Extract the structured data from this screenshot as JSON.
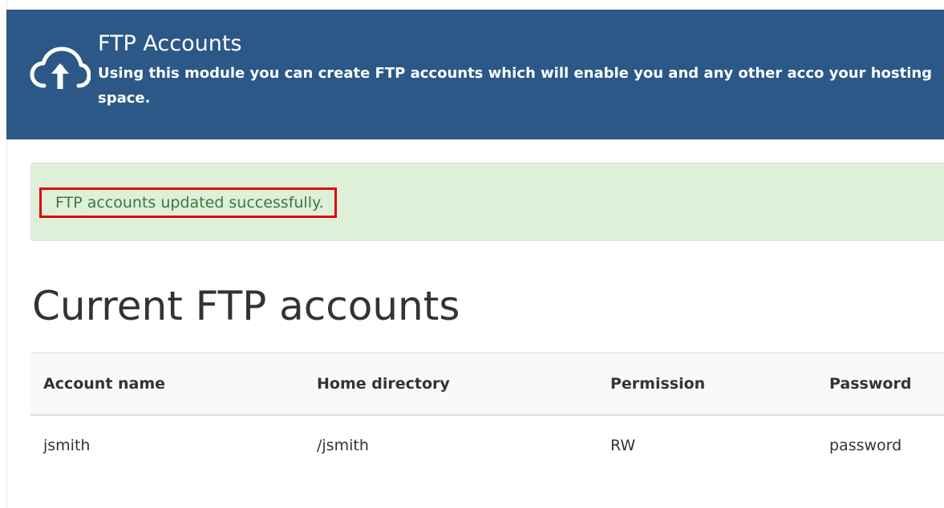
{
  "header": {
    "title": "FTP Accounts",
    "description": "Using this module you can create FTP accounts which will enable you and any other acco your hosting space.",
    "icon": "cloud-upload-icon",
    "background_color": "#2c5888"
  },
  "alert": {
    "message": "FTP accounts updated successfully.",
    "background_color": "#dff0d8",
    "text_color": "#3c763d",
    "highlight_color": "#dd0b0b"
  },
  "section": {
    "title": "Current FTP accounts"
  },
  "table": {
    "columns": [
      "Account name",
      "Home directory",
      "Permission",
      "Password"
    ],
    "rows": [
      [
        "jsmith",
        "/jsmith",
        "RW",
        "password"
      ]
    ]
  }
}
